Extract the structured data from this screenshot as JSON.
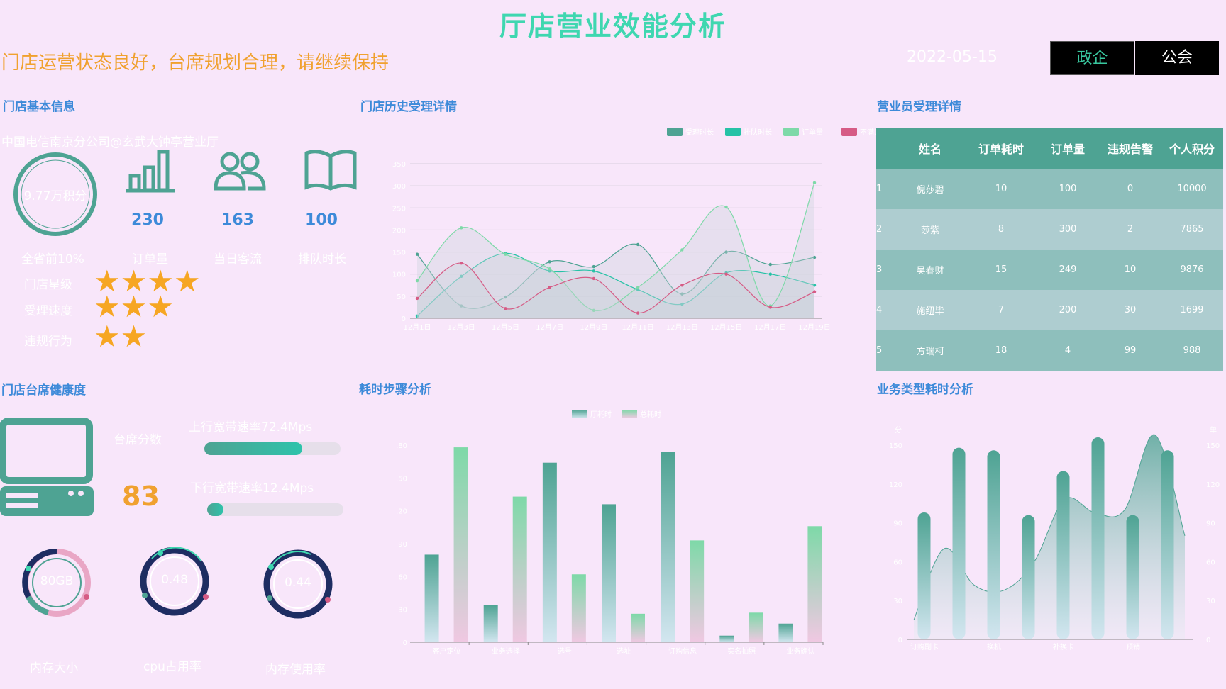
{
  "header": {
    "title": "厅店营业效能分析",
    "status_message": "门店运营状态良好，台席规划合理，请继续保持",
    "date": "2022-05-15",
    "buttons": [
      {
        "label": "政企"
      },
      {
        "label": "公会"
      }
    ]
  },
  "colors": {
    "background": "#f8e6fa",
    "accent": "#3fd7b0",
    "teal": "#4ea393",
    "blue": "#3d8ad9",
    "orange": "#f0a12f",
    "pink": "#d65b85"
  },
  "store_info": {
    "section_title": "门店基本信息",
    "store_name": "中国电信南京分公司@玄武大钟亭营业厅",
    "score_ring": "9.77万积分",
    "score_rank": "全省前10%",
    "metrics": [
      {
        "icon": "bar-chart-icon",
        "value": "230",
        "label": "订单量"
      },
      {
        "icon": "users-icon",
        "value": "163",
        "label": "当日客流"
      },
      {
        "icon": "book-icon",
        "value": "100",
        "label": "排队时长"
      }
    ],
    "ratings": [
      {
        "label": "门店星级",
        "stars": 4
      },
      {
        "label": "受理速度",
        "stars": 3
      },
      {
        "label": "违规行为",
        "stars": 2
      }
    ]
  },
  "history": {
    "section_title": "门店历史受理详情",
    "legend": [
      "受理时长",
      "排队时长",
      "订单量",
      "不满意"
    ]
  },
  "staff": {
    "section_title": "营业员受理详情",
    "columns": [
      "",
      "姓名",
      "订单耗时",
      "订单量",
      "违规告警",
      "个人积分"
    ],
    "rows": [
      [
        "1",
        "倪莎碧",
        "10",
        "100",
        "0",
        "10000"
      ],
      [
        "2",
        "莎紫",
        "8",
        "300",
        "2",
        "7865"
      ],
      [
        "3",
        "吴春财",
        "15",
        "249",
        "10",
        "9876"
      ],
      [
        "4",
        "施纽毕",
        "7",
        "200",
        "30",
        "1699"
      ],
      [
        "5",
        "方瑞柯",
        "18",
        "4",
        "99",
        "988"
      ]
    ]
  },
  "health": {
    "section_title": "门店台席健康度",
    "seat_score_label": "台席分数",
    "seat_score": "83",
    "upload_label": "上行宽带速率72.4Mps",
    "upload_fill": 0.72,
    "download_label": "下行宽带速率12.4Mps",
    "download_fill": 0.12,
    "gauges": [
      {
        "value": "80GB",
        "label": "内存大小"
      },
      {
        "value": "0.48",
        "label": "cpu占用率"
      },
      {
        "value": "0.44",
        "label": "内存使用率"
      }
    ]
  },
  "chart_data": [
    {
      "type": "area",
      "title": "门店历史受理详情",
      "categories": [
        "12月1日",
        "12月3日",
        "12月5日",
        "12月7日",
        "12月9日",
        "12月11日",
        "12月13日",
        "12月15日",
        "12月17日",
        "12月19日"
      ],
      "ylim": [
        0,
        350
      ],
      "yticks": [
        0,
        50,
        100,
        150,
        200,
        250,
        300,
        350
      ],
      "legend_position": "top-right",
      "series": [
        {
          "name": "受理时长",
          "color": "#4ea393",
          "values": [
            145,
            28,
            48,
            128,
            117,
            167,
            55,
            150,
            122,
            138
          ]
        },
        {
          "name": "排队时长",
          "color": "#26c2a6",
          "values": [
            5,
            95,
            147,
            107,
            107,
            65,
            32,
            103,
            100,
            75
          ]
        },
        {
          "name": "订单量",
          "color": "#7ed9a8",
          "values": [
            85,
            205,
            145,
            112,
            18,
            70,
            155,
            252,
            28,
            307
          ]
        },
        {
          "name": "不满意",
          "color": "#d65b85",
          "values": [
            45,
            125,
            22,
            70,
            90,
            12,
            75,
            100,
            25,
            60
          ]
        }
      ]
    },
    {
      "type": "bar",
      "title": "耗时步骤分析",
      "categories": [
        "客户定位",
        "业务选择",
        "选号",
        "选址",
        "订购信息",
        "实名拍照",
        "业务确认"
      ],
      "ylim": [
        0,
        180
      ],
      "yticks": [
        0,
        30,
        60,
        90,
        120,
        150,
        180
      ],
      "legend_position": "top-center",
      "series": [
        {
          "name": "厅耗时",
          "values": [
            80,
            34,
            164,
            126,
            174,
            6,
            17
          ]
        },
        {
          "name": "总耗时",
          "values": [
            178,
            133,
            62,
            26,
            93,
            27,
            106
          ]
        }
      ]
    },
    {
      "type": "bar",
      "title": "业务类型耗时分析",
      "categories": [
        "订购副卡",
        "换机",
        "补换卡",
        "预销"
      ],
      "ylim": [
        0,
        150
      ],
      "yticks_left": [
        0,
        30,
        60,
        90,
        120,
        150
      ],
      "yticks_right": [
        0,
        30,
        60,
        90,
        120,
        150
      ],
      "yaxis_left_label": "分",
      "yaxis_right_label": "单",
      "series": [
        {
          "name": "bars",
          "values": [
            98,
            148,
            146,
            96,
            130,
            156,
            96,
            146
          ]
        },
        {
          "name": "area",
          "values": [
            15,
            70,
            42,
            38,
            60,
            108,
            98,
            100,
            158,
            80
          ]
        }
      ]
    }
  ]
}
